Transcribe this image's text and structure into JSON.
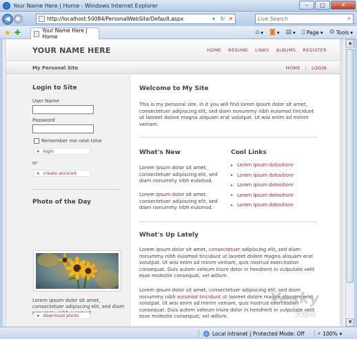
{
  "window": {
    "title": "Your Name Here | Home - Windows Internet Explorer",
    "minimize": "–",
    "maximize": "□",
    "close": "✕"
  },
  "address_bar": {
    "url": "http://localhost:50084/PersonalWebSite/Default.aspx",
    "search_placeholder": "Live Search"
  },
  "tab": {
    "label": "Your Name Here | Home"
  },
  "commands": {
    "page": "Page",
    "tools": "Tools"
  },
  "site": {
    "name": "YOUR NAME HERE",
    "tagline": "My Personal Site",
    "nav": [
      "HOME",
      "RESUME",
      "LINKS",
      "ALBUMS",
      "REGISTER"
    ],
    "subnav": [
      "HOME",
      "LOGIN"
    ]
  },
  "sidebar": {
    "login_heading": "Login to Site",
    "user_name_label": "User Name",
    "password_label": "Password",
    "remember_label": "Remember me next time",
    "login_button": "login",
    "or_text": "or",
    "create_account_button": "create account",
    "photo_heading": "Photo of the Day",
    "photo_caption": "Lorem ipsum dolor sit amet, consectetuer adipiscing elit, sed diam nonummy nibh euismod",
    "download_button": "download photo"
  },
  "content": {
    "welcome_heading": "Welcome to My Site",
    "welcome_text": "This is my personal site. In it you will find lorem ipsum dolor sit amet, consectetuer adipiscing elit, sed diam nonummy nibh euismod tincidunt ut laoreet dolore magna aliquam erat volutpat. Ut wisi enim ad minim veniam.",
    "whats_new_heading": "What's New",
    "news_1_pre": "Lorem ",
    "news_1_link": "ipsum",
    "news_1_post": " dolor sit amet, consectetuer adipiscing elit, sed diam nonummy nibh euismod.",
    "news_2_pre": "Lorem ",
    "news_2_link": "ipsum",
    "news_2_post": " dolor sit amet, consectetuer adipiscing elit, sed diam nonummy nibh euismod.",
    "cool_links_heading": "Cool Links",
    "cool_links": [
      "Lorem ipsum dolositionr",
      "Lorem ipsum dolositionr",
      "Lorem ipsum dolositionr",
      "Lorem ipsum dolositionr",
      "Lorem ipsum dolositionr"
    ],
    "whats_up_heading": "What's Up Lately",
    "up_1_pre": "Lorem ipsum dolor sit amet, ",
    "up_1_link": "consectetuer",
    "up_1_post": " adipiscing elit, sed diam nonummy nibh euismod tincidunt ut laoreet dolore magna aliquam erat volutpat. Ut wisi enim ad minim veniam, quis nostrud exercitation consequat. Duis autem veleum iriure dolor in hendrerit in vulputate velit esse molestie consequat, vel willum.",
    "up_2_pre": "Lorem ipsum dolor sit amet, consectetuer adipiscing elit, sed diam nonummy nibh ",
    "up_2_link": "euismod tincidunt ut",
    "up_2_post": " laoreet dolore magna aliquam erat volutpat. Ut wisi enim ad minim veniam, quis nostrud exercitation consequat. Duis autem veleum iriure dolor in hendrerit in vulputate velit esse molestie consequat, vel willum."
  },
  "status_bar": {
    "zone": "Local intranet | Protected Mode: Off",
    "zoom": "100%"
  },
  "watermark": {
    "logo": "Yesky",
    "sub": "天极网"
  },
  "icons": {
    "back": "back-arrow-icon",
    "forward": "forward-arrow-icon",
    "refresh": "refresh-icon",
    "stop": "stop-icon",
    "search": "search-icon",
    "favorites": "favorites-star-icon",
    "add_favorites": "add-favorites-icon",
    "home": "home-icon",
    "feeds": "feeds-icon",
    "print": "print-icon"
  }
}
